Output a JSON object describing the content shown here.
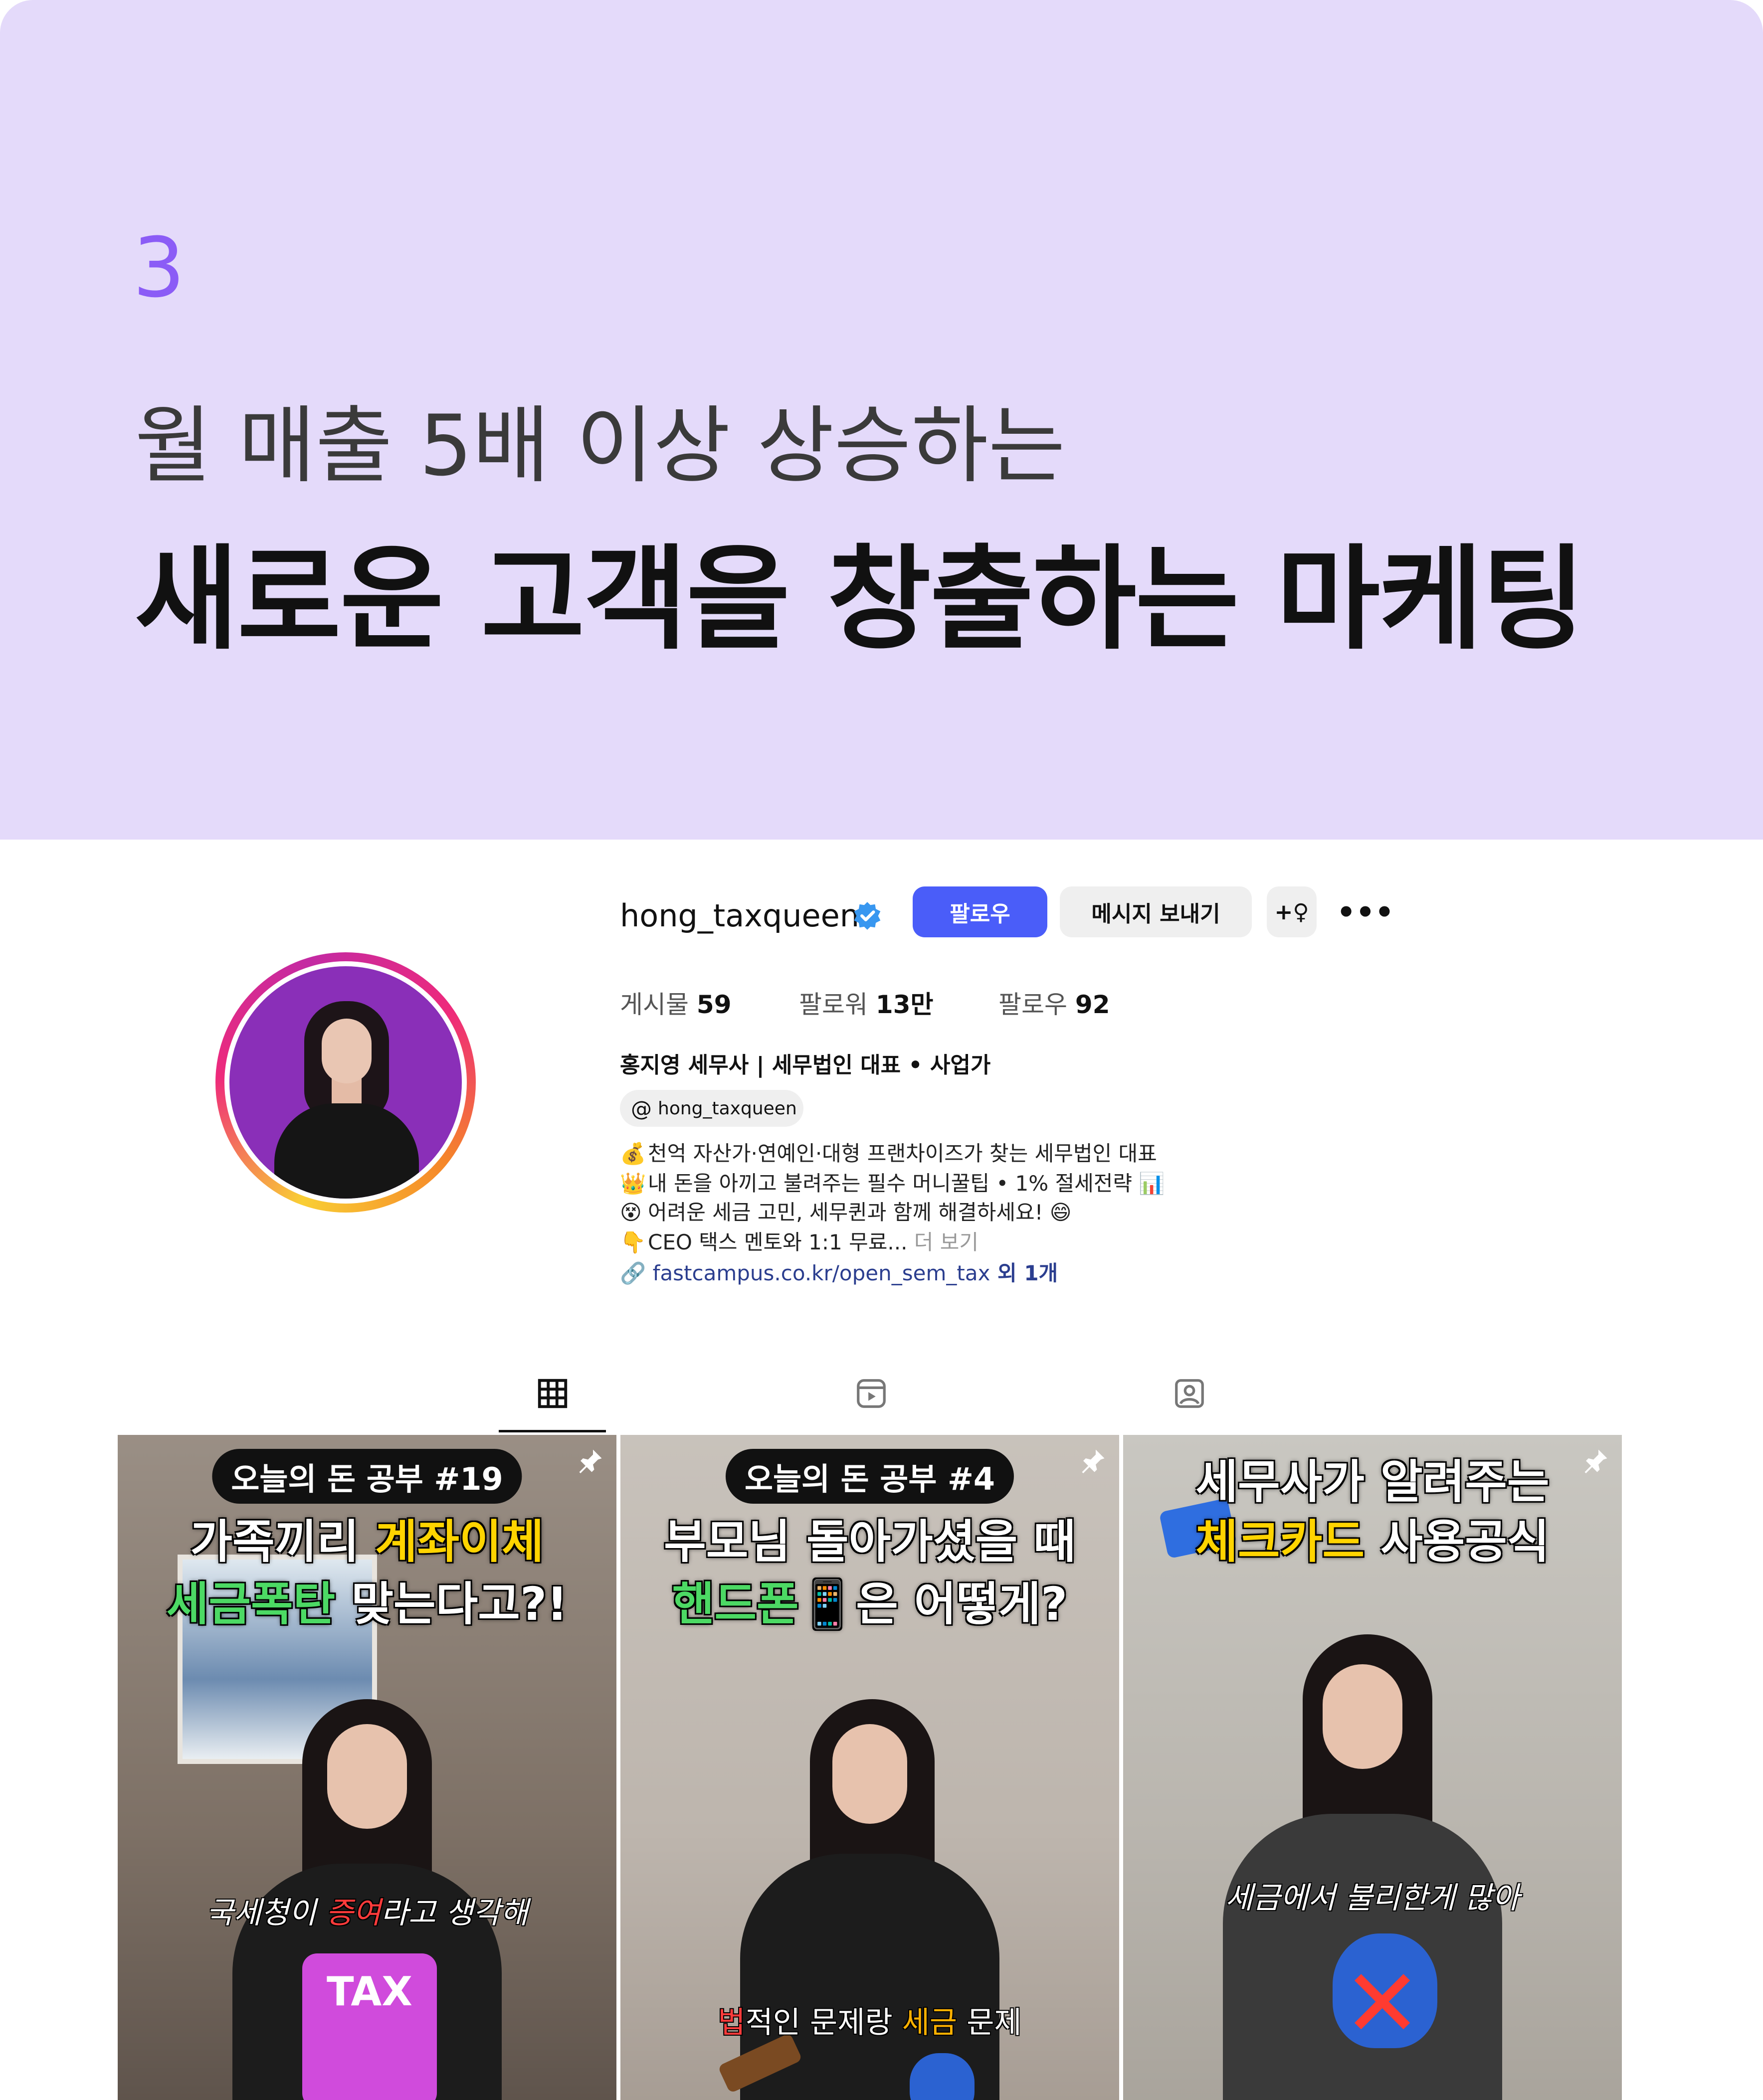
{
  "header": {
    "step_number": "3",
    "subtitle": "월 매출 5배 이상 상승하는",
    "title": "새로운 고객을 창출하는 마케팅"
  },
  "profile": {
    "username": "hong_taxqueen",
    "verified": true,
    "follow_label": "팔로우",
    "message_label": "메시지 보내기",
    "add_user_icon": "+♀",
    "more_icon": "•••",
    "stats": {
      "posts_label": "게시물",
      "posts_value": "59",
      "followers_label": "팔로워",
      "followers_value": "13만",
      "following_label": "팔로우",
      "following_value": "92"
    },
    "full_name": "홍지영 세무사 | 세무법인 대표 • 사업가",
    "threads_handle": "hong_taxqueen",
    "bio": [
      {
        "emoji": "💰",
        "text": "천억 자산가·연예인·대형 프랜차이즈가 찾는 세무법인 대표"
      },
      {
        "emoji": "👑",
        "text": "내 돈을 아끼고 불려주는 필수 머니꿀팁 • 1% 절세전략 📊"
      },
      {
        "emoji": "😵",
        "text": "어려운 세금 고민, 세무퀸과 함께 해결하세요! 😄"
      },
      {
        "emoji": "👇",
        "text": "CEO 택스 멘토와 1:1 무료...",
        "more": " 더 보기"
      }
    ],
    "link": "fastcampus.co.kr/open_sem_tax",
    "link_extra": " 외 1개",
    "brand_colors": {
      "follow": "#4a5df9",
      "verified": "#3897f0",
      "accent": "#8b5cf6"
    }
  },
  "tabs": [
    {
      "name": "grid",
      "icon": "grid-icon",
      "active": true
    },
    {
      "name": "reels",
      "icon": "reels-icon",
      "active": false
    },
    {
      "name": "tagged",
      "icon": "tagged-icon",
      "active": false
    }
  ],
  "posts": [
    {
      "pill": "오늘의 돈 공부 #19",
      "line1_a": "가족끼리 ",
      "line1_b": "계좌이체",
      "line2_a": "세금폭탄",
      "line2_b": " 맞는다고?!",
      "caption_a": "국세청이 ",
      "caption_b": "증여",
      "caption_c": "라고 생각해",
      "sticker": "TAX"
    },
    {
      "pill": "오늘의 돈 공부 #4",
      "line1": "부모님 돌아가셨을 때",
      "line2_a": "핸드폰",
      "line2_b": "📱은 어떻게?",
      "caption_a": "법",
      "caption_b": "적인 문제랑 ",
      "caption_c": "세금",
      "caption_d": " 문제"
    },
    {
      "line1": "세무사가 알려주는",
      "line2_a": "체크카드",
      "line2_b": " 사용공식",
      "caption": "세금에서 불리한게 많아"
    }
  ]
}
